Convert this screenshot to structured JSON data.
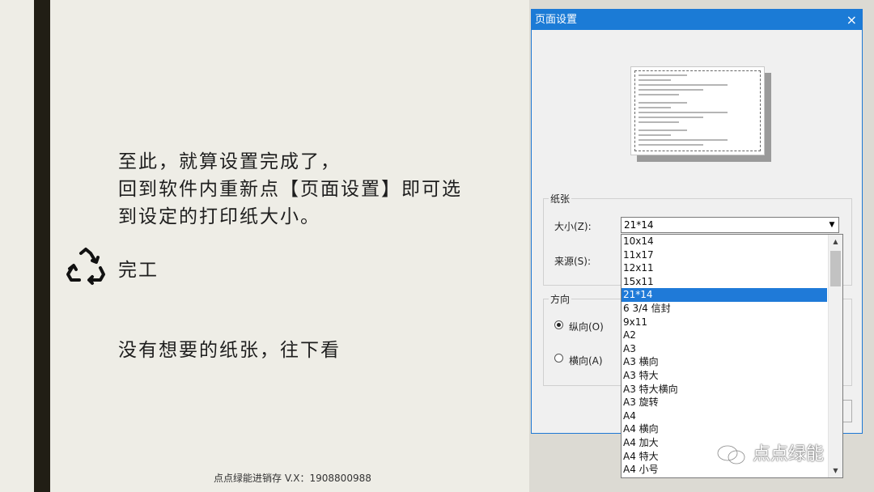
{
  "slide": {
    "text_lines": [
      "至此，就算设置完成了，",
      "回到软件内重新点【页面设置】即可选",
      "到设定的打印纸大小。"
    ],
    "done": "完工",
    "hint": "没有想要的纸张，往下看",
    "footer": "点点绿能进销存 V.X：1908800988"
  },
  "dialog": {
    "title": "页面设置",
    "close_icon": "×",
    "paper_group": "纸张",
    "size_label": "大小(Z):",
    "size_value": "21*14",
    "source_label": "来源(S):",
    "orientation_group": "方向",
    "portrait": "纵向(O)",
    "landscape": "横向(A)",
    "orientation_selected": "portrait",
    "size_options": [
      "10x14",
      "11x17",
      "12x11",
      "15x11",
      "21*14",
      "6 3/4 信封",
      "9x11",
      "A2",
      "A3",
      "A3 横向",
      "A3 特大",
      "A3 特大横向",
      "A3 旋转",
      "A4",
      "A4 横向",
      "A4 加大",
      "A4 特大",
      "A4 小号"
    ],
    "selected_option": "21*14"
  },
  "watermark": {
    "text": "点点绿能"
  },
  "colors": {
    "accent": "#1f7ad8",
    "bar": "#211e15",
    "background": "#eeede6"
  }
}
